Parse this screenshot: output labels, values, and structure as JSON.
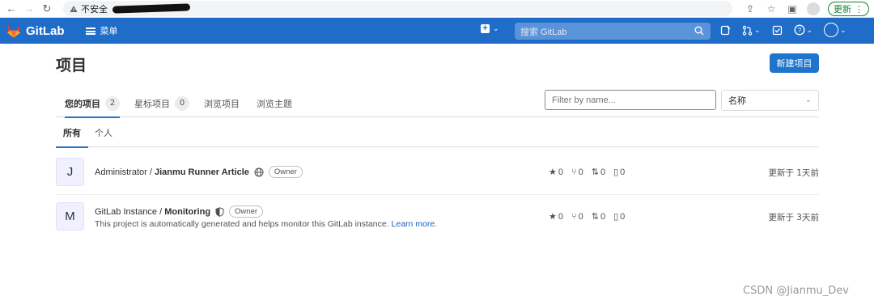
{
  "browser": {
    "insecure_label": "不安全",
    "update_label": "更新"
  },
  "header": {
    "brand": "GitLab",
    "menu_label": "菜单",
    "search_placeholder": "搜索 GitLab",
    "brand_color": "#1f6dc9"
  },
  "page": {
    "title": "项目",
    "new_project_label": "新建项目"
  },
  "tabs": [
    {
      "label": "您的项目",
      "count": "2"
    },
    {
      "label": "星标项目",
      "count": "0"
    },
    {
      "label": "浏览项目"
    },
    {
      "label": "浏览主题"
    }
  ],
  "filter": {
    "placeholder": "Filter by name...",
    "sort_value": "名称"
  },
  "subtabs": [
    {
      "label": "所有"
    },
    {
      "label": "个人"
    }
  ],
  "projects": [
    {
      "avatar_letter": "J",
      "namespace": "Administrator / ",
      "name": "Jianmu Runner Article",
      "visibility_icon": "globe-icon",
      "role": "Owner",
      "description": "",
      "stars": "0",
      "forks": "0",
      "merge_requests": "0",
      "issues": "0",
      "updated": "更新于 1天前"
    },
    {
      "avatar_letter": "M",
      "namespace": "GitLab Instance / ",
      "name": "Monitoring",
      "visibility_icon": "shield-icon",
      "role": "Owner",
      "description": "This project is automatically generated and helps monitor this GitLab instance.",
      "learn_more": "Learn more.",
      "stars": "0",
      "forks": "0",
      "merge_requests": "0",
      "issues": "0",
      "updated": "更新于 3天前"
    }
  ],
  "watermark": "CSDN @Jianmu_Dev"
}
